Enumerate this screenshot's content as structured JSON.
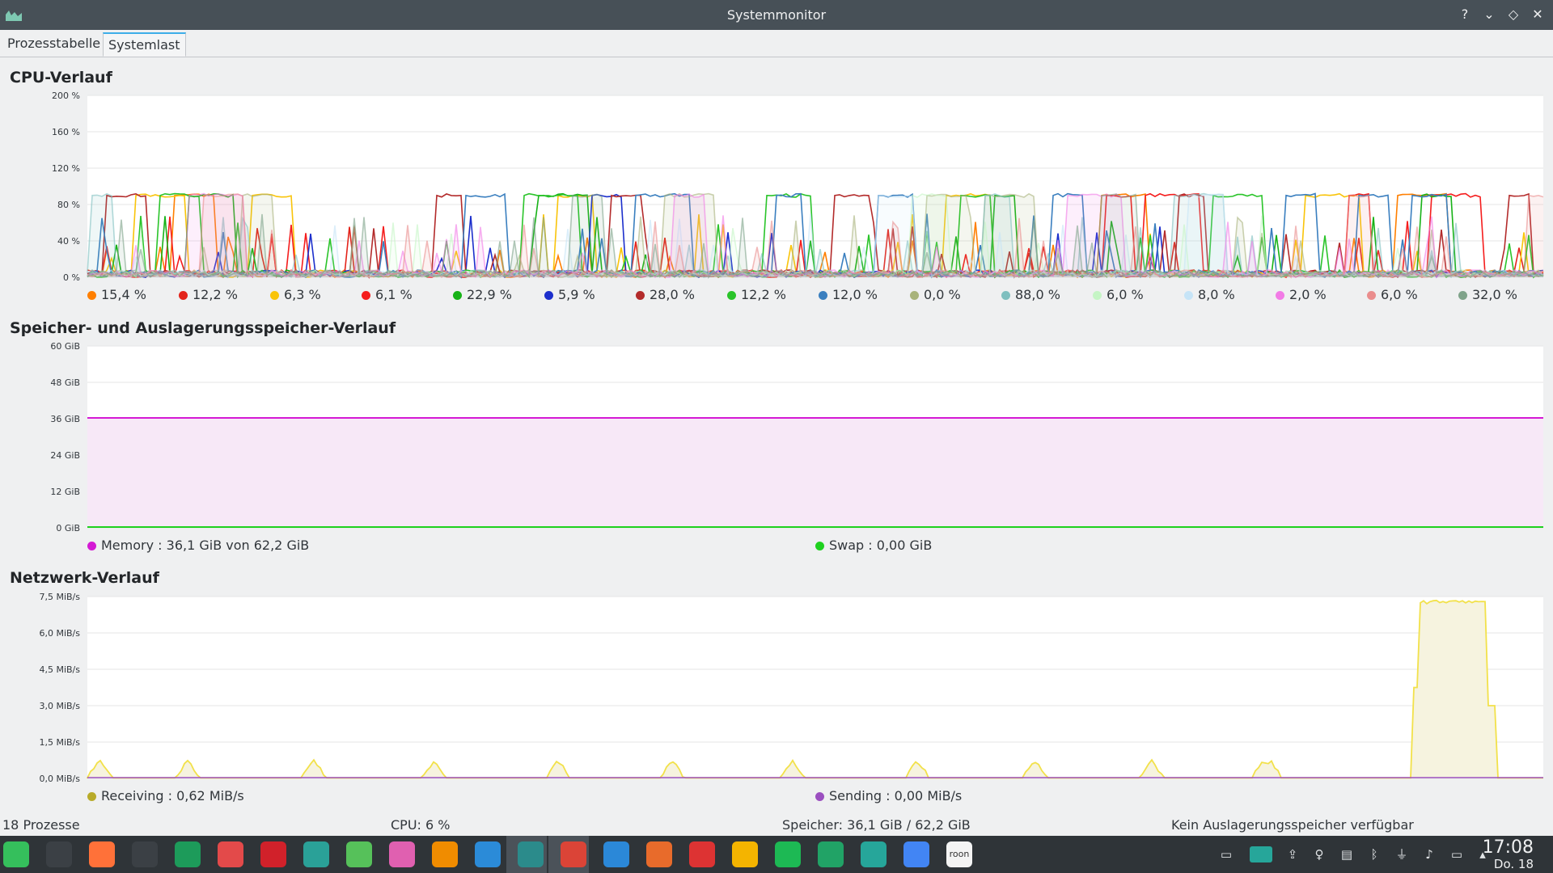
{
  "window": {
    "title": "Systemmonitor",
    "help": "?",
    "minimize": "⌄",
    "maximize": "◇",
    "close": "✕"
  },
  "tabs": [
    {
      "label": "Prozesstabelle"
    },
    {
      "label": "Systemlast"
    }
  ],
  "cpu": {
    "title": "CPU-Verlauf",
    "ylabels": [
      "200 %",
      "160 %",
      "120 %",
      "80 %",
      "40 %",
      "0 %"
    ],
    "legend": [
      {
        "value": "15,4 %",
        "color": "#ff7f00"
      },
      {
        "value": "12,2 %",
        "color": "#e3241b"
      },
      {
        "value": "6,3 %",
        "color": "#f9c40a"
      },
      {
        "value": "6,1 %",
        "color": "#f51d1d"
      },
      {
        "value": "22,9 %",
        "color": "#17b217"
      },
      {
        "value": "5,9 %",
        "color": "#1c2fcc"
      },
      {
        "value": "28,0 %",
        "color": "#b32b2b"
      },
      {
        "value": "12,2 %",
        "color": "#2ac42a"
      },
      {
        "value": "12,0 %",
        "color": "#3a7fbf"
      },
      {
        "value": "0,0 %",
        "color": "#a8b37b"
      },
      {
        "value": "88,0 %",
        "color": "#7fbfbf"
      },
      {
        "value": "6,0 %",
        "color": "#c5f5c5"
      },
      {
        "value": "8,0 %",
        "color": "#c6e4f7"
      },
      {
        "value": "2,0 %",
        "color": "#f27be6"
      },
      {
        "value": "6,0 %",
        "color": "#ea8d8d"
      },
      {
        "value": "32,0 %",
        "color": "#7fa38a"
      }
    ]
  },
  "memory": {
    "title": "Speicher- und Auslagerungsspeicher-Verlauf",
    "ylabels": [
      "60 GiB",
      "48 GiB",
      "36 GiB",
      "24 GiB",
      "12 GiB",
      "0 GiB"
    ],
    "legend": [
      {
        "label": "Memory : 36,1 GiB von 62,2 GiB",
        "color": "#d41ad4"
      },
      {
        "label": "Swap : 0,00 GiB",
        "color": "#1fd11f"
      }
    ]
  },
  "network": {
    "title": "Netzwerk-Verlauf",
    "ylabels": [
      "7,5 MiB/s",
      "6,0 MiB/s",
      "4,5 MiB/s",
      "3,0 MiB/s",
      "1,5 MiB/s",
      "0,0 MiB/s"
    ],
    "legend": [
      {
        "label": "Receiving : 0,62 MiB/s",
        "color": "#b8ab2a"
      },
      {
        "label": "Sending : 0,00 MiB/s",
        "color": "#9b4fc0"
      }
    ]
  },
  "status": {
    "processes": "18 Prozesse",
    "cpu": "CPU: 6 %",
    "memory": "Speicher: 36,1 GiB / 62,2 GiB",
    "swap": "Kein Auslagerungsspeicher verfügbar"
  },
  "taskbar": {
    "icons": [
      {
        "name": "manjaro-menu-icon",
        "color": "#35bf5c"
      },
      {
        "name": "settings-manager-icon",
        "color": "#3b4045"
      },
      {
        "name": "firefox-icon",
        "color": "#ff7139"
      },
      {
        "name": "terminal-icon",
        "color": "#3b4045"
      },
      {
        "name": "pacman-icon",
        "color": "#1d9b5a"
      },
      {
        "name": "lifebuoy-icon",
        "color": "#e34a4a"
      },
      {
        "name": "jetbrains-icon",
        "color": "#d1212a"
      },
      {
        "name": "network-icon",
        "color": "#2aa198"
      },
      {
        "name": "download-icon",
        "color": "#56c15a"
      },
      {
        "name": "eye-icon",
        "color": "#e060b0"
      },
      {
        "name": "vlc-icon",
        "color": "#f08c00"
      },
      {
        "name": "info-icon",
        "color": "#2b8bd8"
      },
      {
        "name": "system-monitor-icon",
        "color": "#2b8b8b"
      },
      {
        "name": "chrome-icon",
        "color": "#db4437"
      },
      {
        "name": "document-icon",
        "color": "#2b88d8"
      },
      {
        "name": "presentation-icon",
        "color": "#e86b2b"
      },
      {
        "name": "cards-icon",
        "color": "#d33"
      },
      {
        "name": "photos-icon",
        "color": "#f4b400"
      },
      {
        "name": "spotify-icon",
        "color": "#1db954"
      },
      {
        "name": "spreadsheet-icon",
        "color": "#21a366"
      },
      {
        "name": "files-icon",
        "color": "#26a69a"
      },
      {
        "name": "pinwheel-icon",
        "color": "#4285f4"
      },
      {
        "name": "roon-icon",
        "color": "#f4f4f4"
      }
    ],
    "roon_label": "roon",
    "clock_time": "17:08",
    "clock_date": "Do. 18"
  }
}
